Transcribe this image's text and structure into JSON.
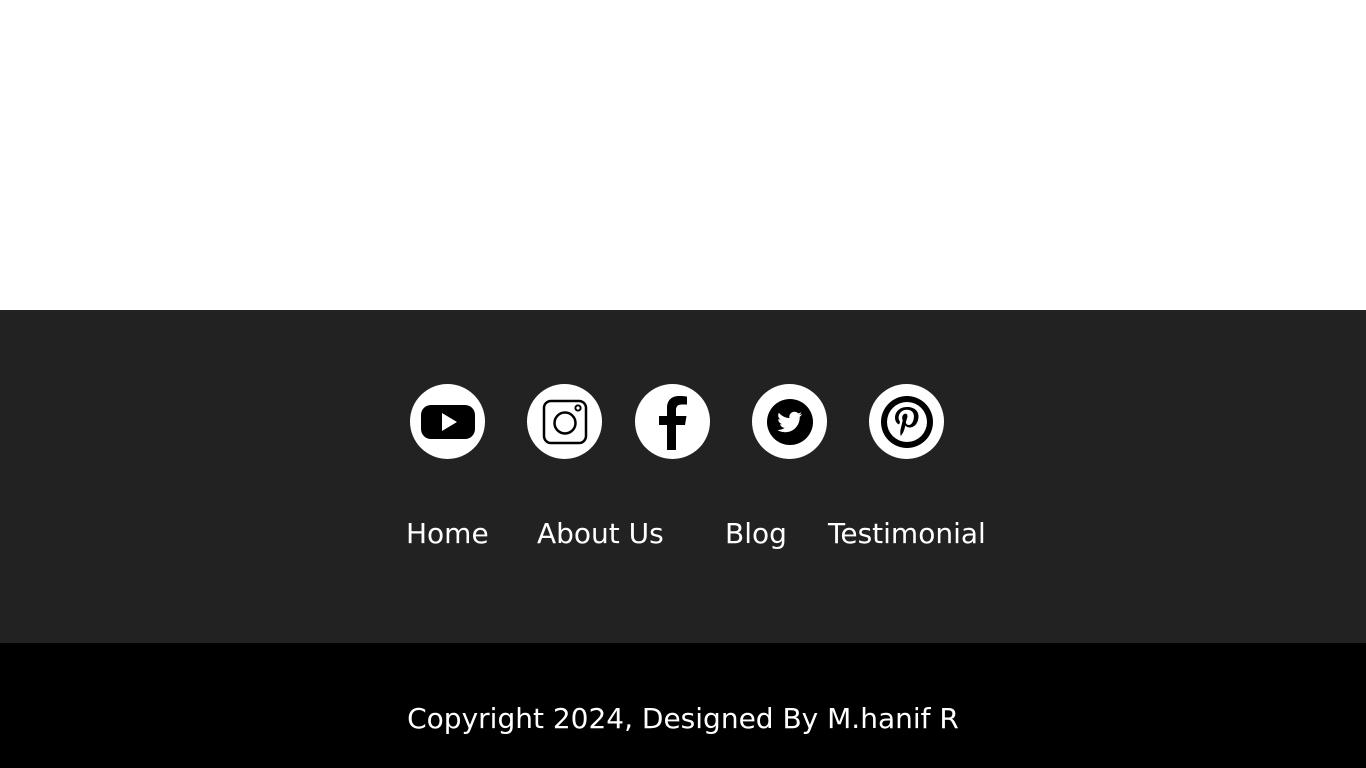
{
  "social": [
    {
      "name": "youtube",
      "icon": "youtube-icon"
    },
    {
      "name": "instagram",
      "icon": "instagram-icon"
    },
    {
      "name": "facebook",
      "icon": "facebook-icon"
    },
    {
      "name": "twitter",
      "icon": "twitter-icon"
    },
    {
      "name": "pinterest",
      "icon": "pinterest-icon"
    }
  ],
  "nav": {
    "items": [
      {
        "label": "Home"
      },
      {
        "label": "About Us"
      },
      {
        "label": "Blog"
      },
      {
        "label": "Testimonial"
      }
    ]
  },
  "footer": {
    "copyright": "Copyright 2024, Designed By M.hanif R"
  },
  "colors": {
    "footer_bg": "#232223",
    "copyright_bg": "#000000",
    "text": "#ffffff",
    "icon_bg": "#ffffff",
    "icon_fg": "#000000"
  }
}
